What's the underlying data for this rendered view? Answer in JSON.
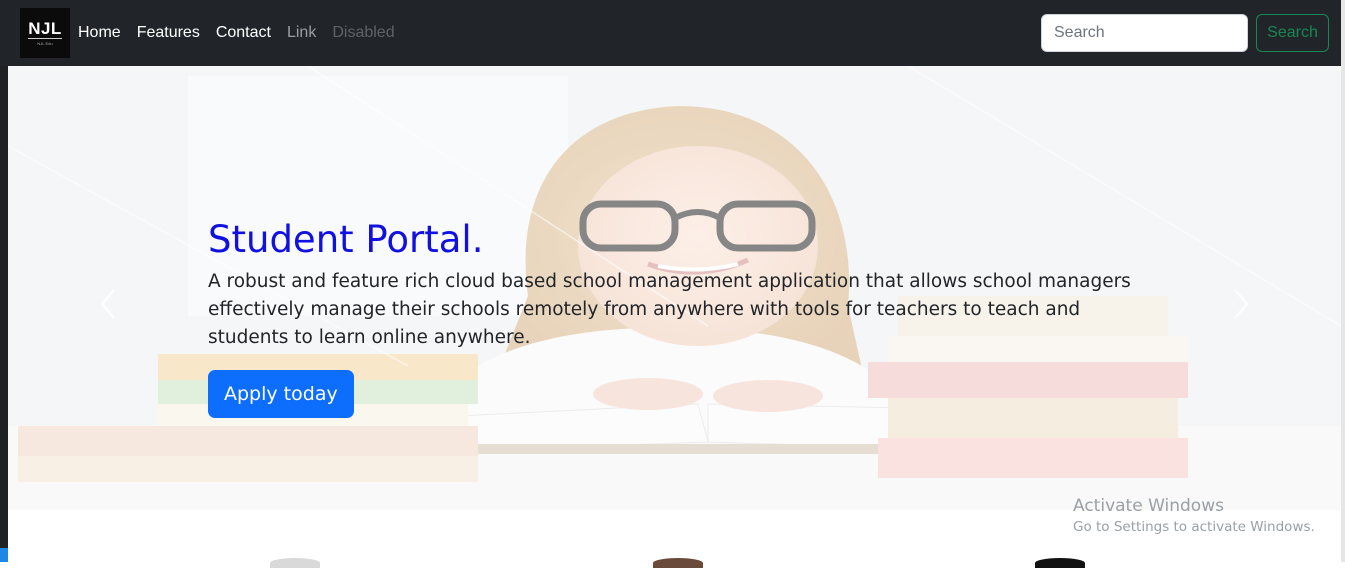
{
  "navbar": {
    "brand": {
      "mark": "NJL",
      "sub": "NJL Edu"
    },
    "links": [
      {
        "label": "Home",
        "state": "active"
      },
      {
        "label": "Features",
        "state": "active"
      },
      {
        "label": "Contact",
        "state": "active"
      },
      {
        "label": "Link",
        "state": "muted"
      },
      {
        "label": "Disabled",
        "state": "disabled"
      }
    ],
    "search": {
      "placeholder": "Search",
      "value": "",
      "button_label": "Search"
    }
  },
  "hero": {
    "title": "Student Portal.",
    "text": "A robust and feature rich cloud based school management application that allows school managers effectively manage their schools remotely from anywhere with tools for teachers to teach and students to learn online anywhere.",
    "cta_label": "Apply today",
    "prev_icon": "chevron-left-icon",
    "next_icon": "chevron-right-icon"
  },
  "watermark": {
    "title": "Activate Windows",
    "subtitle": "Go to Settings to activate Windows."
  },
  "colors": {
    "navbar_bg": "#212529",
    "title_blue": "#1010e0",
    "primary": "#0d6efd",
    "success": "#198754"
  }
}
